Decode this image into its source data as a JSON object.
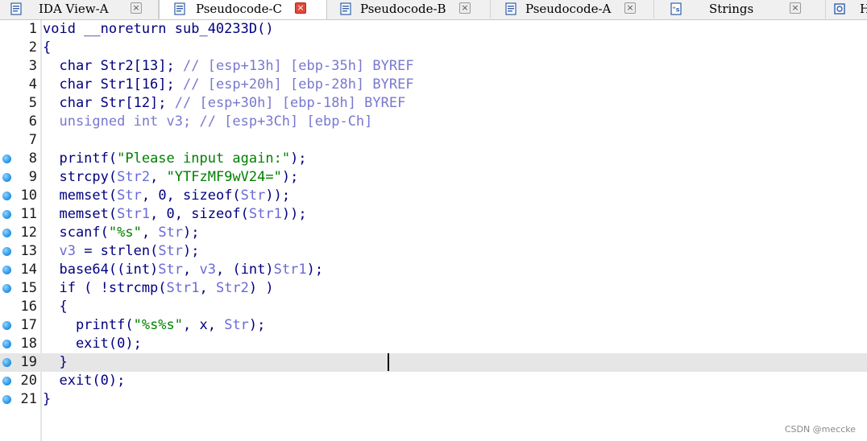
{
  "tabs": [
    {
      "label": "IDA View-A",
      "icon": "ida-view-icon",
      "active": false
    },
    {
      "label": "Pseudocode-C",
      "icon": "pseudocode-icon",
      "active": true
    },
    {
      "label": "Pseudocode-B",
      "icon": "pseudocode-icon",
      "active": false
    },
    {
      "label": "Pseudocode-A",
      "icon": "pseudocode-icon",
      "active": false
    },
    {
      "label": "Strings",
      "icon": "strings-icon",
      "active": false
    },
    {
      "label": "H",
      "icon": "hex-view-icon",
      "active": false
    }
  ],
  "tab_close_glyph": "×",
  "code_lines": [
    {
      "num": "1",
      "bp": false,
      "tokens": [
        [
          "plain",
          "void __noreturn sub_40233D()"
        ]
      ]
    },
    {
      "num": "2",
      "bp": false,
      "tokens": [
        [
          "plain",
          "{"
        ]
      ]
    },
    {
      "num": "3",
      "bp": false,
      "tokens": [
        [
          "plain",
          "  char Str2[13]; "
        ],
        [
          "cmt",
          "// [esp+13h] [ebp-35h] BYREF"
        ]
      ]
    },
    {
      "num": "4",
      "bp": false,
      "tokens": [
        [
          "plain",
          "  char Str1[16]; "
        ],
        [
          "cmt",
          "// [esp+20h] [ebp-28h] BYREF"
        ]
      ]
    },
    {
      "num": "5",
      "bp": false,
      "tokens": [
        [
          "plain",
          "  char Str[12]; "
        ],
        [
          "cmt",
          "// [esp+30h] [ebp-18h] BYREF"
        ]
      ]
    },
    {
      "num": "6",
      "bp": false,
      "tokens": [
        [
          "cmt",
          "  unsigned int v3; // [esp+3Ch] [ebp-Ch]"
        ]
      ]
    },
    {
      "num": "7",
      "bp": false,
      "tokens": [
        [
          "plain",
          ""
        ]
      ]
    },
    {
      "num": "8",
      "bp": true,
      "tokens": [
        [
          "plain",
          "  printf("
        ],
        [
          "str",
          "\"Please input again:\""
        ],
        [
          "plain",
          ");"
        ]
      ]
    },
    {
      "num": "9",
      "bp": true,
      "tokens": [
        [
          "plain",
          "  strcpy("
        ],
        [
          "var",
          "Str2"
        ],
        [
          "plain",
          ", "
        ],
        [
          "str",
          "\"YTFzMF9wV24=\""
        ],
        [
          "plain",
          ");"
        ]
      ]
    },
    {
      "num": "10",
      "bp": true,
      "tokens": [
        [
          "plain",
          "  memset("
        ],
        [
          "var",
          "Str"
        ],
        [
          "plain",
          ", 0, sizeof("
        ],
        [
          "var",
          "Str"
        ],
        [
          "plain",
          "));"
        ]
      ]
    },
    {
      "num": "11",
      "bp": true,
      "tokens": [
        [
          "plain",
          "  memset("
        ],
        [
          "var",
          "Str1"
        ],
        [
          "plain",
          ", 0, sizeof("
        ],
        [
          "var",
          "Str1"
        ],
        [
          "plain",
          "));"
        ]
      ]
    },
    {
      "num": "12",
      "bp": true,
      "tokens": [
        [
          "plain",
          "  scanf("
        ],
        [
          "str",
          "\"%s\""
        ],
        [
          "plain",
          ", "
        ],
        [
          "var",
          "Str"
        ],
        [
          "plain",
          ");"
        ]
      ]
    },
    {
      "num": "13",
      "bp": true,
      "tokens": [
        [
          "var",
          "  v3"
        ],
        [
          "plain",
          " = strlen("
        ],
        [
          "var",
          "Str"
        ],
        [
          "plain",
          ");"
        ]
      ]
    },
    {
      "num": "14",
      "bp": true,
      "tokens": [
        [
          "plain",
          "  base64((int)"
        ],
        [
          "var",
          "Str"
        ],
        [
          "plain",
          ", "
        ],
        [
          "var",
          "v3"
        ],
        [
          "plain",
          ", (int)"
        ],
        [
          "var",
          "Str1"
        ],
        [
          "plain",
          ");"
        ]
      ]
    },
    {
      "num": "15",
      "bp": true,
      "tokens": [
        [
          "plain",
          "  if ( !strcmp("
        ],
        [
          "var",
          "Str1"
        ],
        [
          "plain",
          ", "
        ],
        [
          "var",
          "Str2"
        ],
        [
          "plain",
          ") )"
        ]
      ]
    },
    {
      "num": "16",
      "bp": false,
      "tokens": [
        [
          "plain",
          "  {"
        ]
      ]
    },
    {
      "num": "17",
      "bp": true,
      "tokens": [
        [
          "plain",
          "    printf("
        ],
        [
          "str",
          "\"%s%s\""
        ],
        [
          "plain",
          ", x, "
        ],
        [
          "var",
          "Str"
        ],
        [
          "plain",
          ");"
        ]
      ]
    },
    {
      "num": "18",
      "bp": true,
      "tokens": [
        [
          "plain",
          "    exit(0);"
        ]
      ]
    },
    {
      "num": "19",
      "bp": true,
      "tokens": [
        [
          "plain",
          "  }"
        ]
      ],
      "highlight": true
    },
    {
      "num": "20",
      "bp": true,
      "tokens": [
        [
          "plain",
          "  exit(0);"
        ]
      ]
    },
    {
      "num": "21",
      "bp": true,
      "tokens": [
        [
          "plain",
          "}"
        ]
      ]
    }
  ],
  "watermark": "CSDN @meccke"
}
